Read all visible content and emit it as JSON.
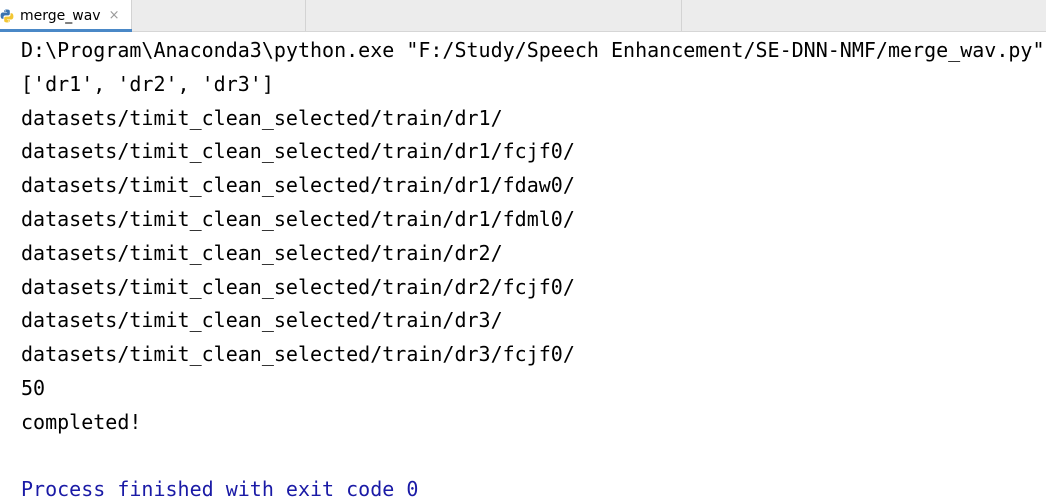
{
  "tab": {
    "label": "merge_wav",
    "close_glyph": "×",
    "icon": "python-file-icon"
  },
  "console": {
    "lines": [
      {
        "type": "cmd",
        "text": "D:\\Program\\Anaconda3\\python.exe \"F:/Study/Speech Enhancement/SE-DNN-NMF/merge_wav.py\""
      },
      {
        "type": "out",
        "text": "['dr1', 'dr2', 'dr3']"
      },
      {
        "type": "out",
        "text": "datasets/timit_clean_selected/train/dr1/"
      },
      {
        "type": "out",
        "text": "datasets/timit_clean_selected/train/dr1/fcjf0/"
      },
      {
        "type": "out",
        "text": "datasets/timit_clean_selected/train/dr1/fdaw0/"
      },
      {
        "type": "out",
        "text": "datasets/timit_clean_selected/train/dr1/fdml0/"
      },
      {
        "type": "out",
        "text": "datasets/timit_clean_selected/train/dr2/"
      },
      {
        "type": "out",
        "text": "datasets/timit_clean_selected/train/dr2/fcjf0/"
      },
      {
        "type": "out",
        "text": "datasets/timit_clean_selected/train/dr3/"
      },
      {
        "type": "out",
        "text": "datasets/timit_clean_selected/train/dr3/fcjf0/"
      },
      {
        "type": "out",
        "text": "50"
      },
      {
        "type": "out",
        "text": "completed!"
      },
      {
        "type": "blank",
        "text": ""
      },
      {
        "type": "exit",
        "text": "Process finished with exit code 0"
      }
    ]
  },
  "colors": {
    "tab_accent": "#4a88c7",
    "exit_text": "#1a1aa6",
    "output_text": "#000000"
  }
}
